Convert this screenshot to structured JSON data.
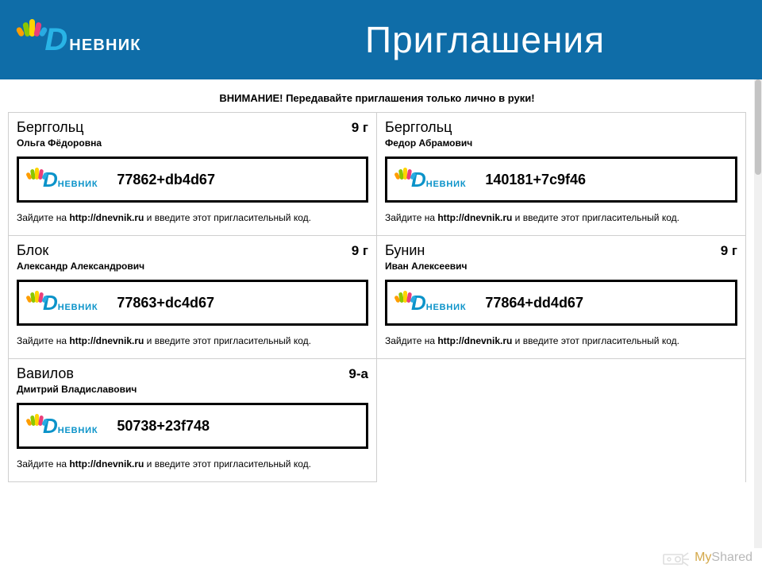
{
  "brand": {
    "D": "D",
    "rest": "НЕВНИК"
  },
  "title": "Приглашения",
  "warning": "ВНИМАНИЕ! Передавайте приглашения только лично в руки!",
  "instruction": {
    "pre": "Зайдите на ",
    "url": "http://dnevnik.ru",
    "post": " и введите этот пригласительный код."
  },
  "cards": [
    {
      "surname": "Берггольц",
      "name": "Ольга Фёдоровна",
      "klass": "9 г",
      "code": "77862+db4d67"
    },
    {
      "surname": "Берггольц",
      "name": "Федор Абрамович",
      "klass": "",
      "code": "140181+7c9f46"
    },
    {
      "surname": "Блок",
      "name": "Александр Александрович",
      "klass": "9 г",
      "code": "77863+dc4d67"
    },
    {
      "surname": "Бунин",
      "name": "Иван Алексеевич",
      "klass": "9 г",
      "code": "77864+dd4d67"
    },
    {
      "surname": "Вавилов",
      "name": "Дмитрий Владиславович",
      "klass": "9-а",
      "code": "50738+23f748"
    }
  ],
  "footer": {
    "my": "My",
    "shared": "Shared"
  }
}
